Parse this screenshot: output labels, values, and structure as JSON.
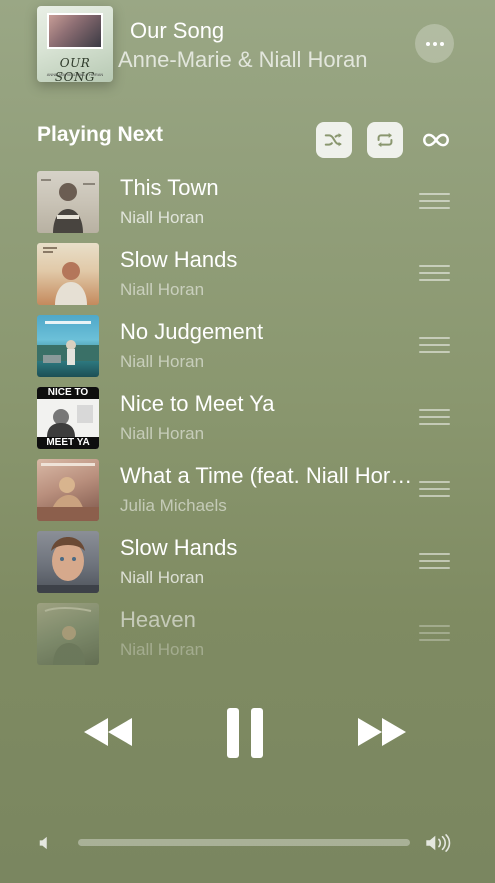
{
  "now_playing": {
    "title": "Our Song",
    "artist": "Anne-Marie & Niall Horan",
    "artwork_icon": "album-art-our-song",
    "artwork_text": "OUR SONG",
    "artwork_subtext": "ANNE-MARIE & NIALL HORAN",
    "more_icon": "ellipsis-icon"
  },
  "queue": {
    "heading": "Playing Next",
    "controls": {
      "shuffle_icon": "shuffle-icon",
      "repeat_icon": "repeat-icon",
      "autoplay_icon": "infinity-icon"
    },
    "tracks": [
      {
        "title": "This Town",
        "artist": "Niall Horan"
      },
      {
        "title": "Slow Hands",
        "artist": "Niall Horan"
      },
      {
        "title": "No Judgement",
        "artist": "Niall Horan"
      },
      {
        "title": "Nice to Meet Ya",
        "artist": "Niall Horan",
        "art_top": "NICE TO",
        "art_bottom": "MEET YA"
      },
      {
        "title": "What a Time (feat. Niall Horan)",
        "artist": "Julia Michaels"
      },
      {
        "title": "Slow Hands",
        "artist": "Niall Horan"
      },
      {
        "title": "Heaven",
        "artist": "Niall Horan"
      }
    ]
  },
  "playback": {
    "rewind_icon": "rewind-icon",
    "pause_icon": "pause-icon",
    "forward_icon": "fast-forward-icon"
  },
  "volume": {
    "low_icon": "volume-low-icon",
    "high_icon": "volume-high-icon",
    "level": 0
  },
  "colors": {
    "background_top": "#9aa785",
    "background_bottom": "#7a8660",
    "control_fill": "#ffffff"
  }
}
